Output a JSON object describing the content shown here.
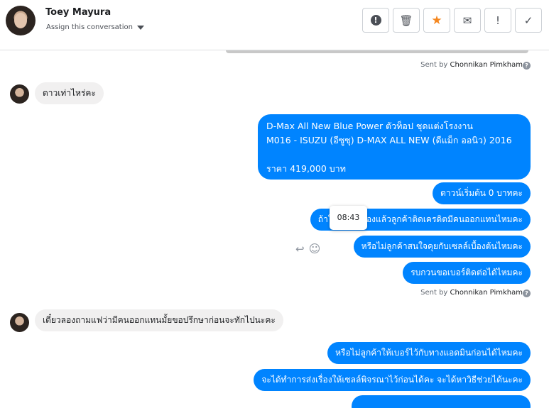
{
  "header": {
    "contact_name": "Toey Mayura",
    "assign_label": "Assign this conversation",
    "actions": {
      "spam": "!",
      "delete": "🗑",
      "star": "★",
      "email": "✉",
      "follow_up": "!",
      "done": "✓"
    }
  },
  "chat": {
    "sent_by_prefix": "Sent by",
    "sent_by_name": "Chonnikan Pimkham",
    "help_glyph": "?",
    "incoming": [
      "ดาวเท่าไหร่คะ",
      "เดี๋ยวลองถามแฟว่ามีคนออกแทนมั้ยขอปรึกษาก่อนจะทักไปนะคะ"
    ],
    "outgoing_block": {
      "line1": "D-Max All New Blue Power ตัวท็อป ชุดแต่งโรงงาน",
      "line2": "M016 - ISUZU (อีซูซุ) D-MAX ALL NEW (ดีแม็ก ออนิว) 2016",
      "line3": "ราคา 419,000 บาท"
    },
    "outgoing": [
      "ดาวน์เริ่มต้น 0 บาทคะ",
      "ถ้าในกรณีที่ลองแล้วลูกค้าติดเครดิตมีคนออกแทนไหมคะ",
      "หรือไม่ลูกค้าสนใจคุยกับเซลล์เบื้องต้นไหมคะ",
      "รบกวนขอเบอร์ติดต่อได้ไหมคะ",
      "หรือไม่ลูกค้าให้เบอร์ไว้กับทางแอดมินก่อนได้ไหมคะ",
      "จะได้ทำการส่งเรื่องให้เซลล์พิจรณาไว้ก่อนได้คะ จะได้หาวิธีช่วยได้นะคะ"
    ],
    "tooltip_time": "08:43",
    "tools": {
      "reply": "↩",
      "emoji": "☺"
    }
  },
  "colors": {
    "outgoing_bubble": "#0084ff",
    "incoming_bubble": "#f1f0f0",
    "star_accent": "#f5871f"
  }
}
